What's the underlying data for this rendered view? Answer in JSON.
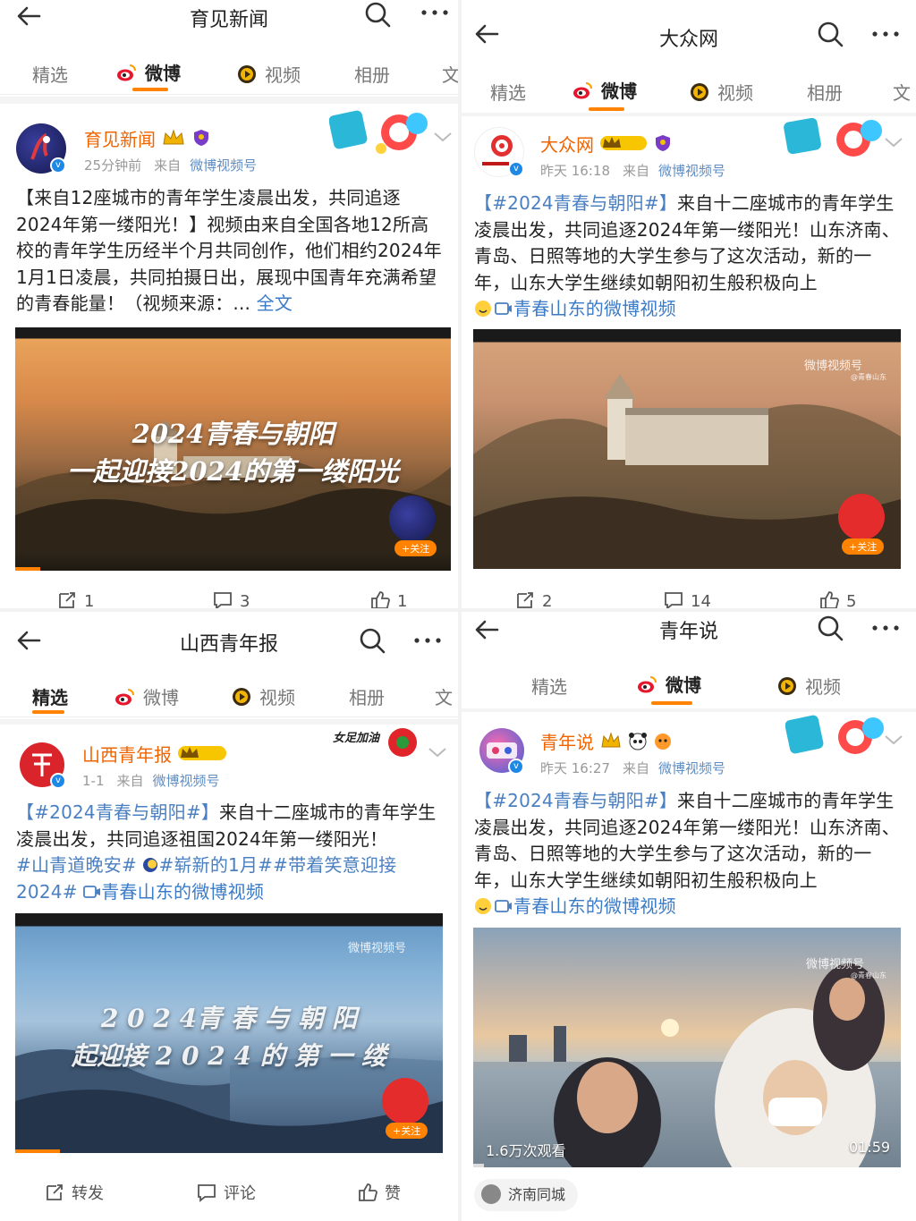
{
  "panels": [
    {
      "title": "育见新闻",
      "tabs": [
        "精选",
        "微博",
        "视频",
        "相册",
        "文"
      ],
      "active_tab": "微博",
      "user": "育见新闻",
      "time": "25分钟前",
      "from": "来自",
      "source": "微博视频号",
      "text_a": "【来自12座城市的青年学生凌晨出发，共同追逐2024年第一缕阳光！】视频由来自全国各地12所高校的青年学生历经半个月共同创作，他们相约2024年1月1日凌晨，共同拍摄日出，展现中国青年充满希望的青春能量！（视频来源：... ",
      "fulltext": "全文",
      "video_line1": "2024青春与朝阳",
      "video_line2": "一起迎接2024的第一缕阳光",
      "follow": "+关注",
      "counts": [
        "1",
        "3",
        "1"
      ]
    },
    {
      "title": "大众网",
      "tabs": [
        "精选",
        "微博",
        "视频",
        "相册",
        "文"
      ],
      "active_tab": "微博",
      "user": "大众网",
      "time": "昨天 16:18",
      "from": "来自",
      "source": "微博视频号",
      "hashtag": "【#2024青春与朝阳#】",
      "text_a": "来自十二座城市的青年学生凌晨出发，共同追逐2024年第一缕阳光！山东济南、青岛、日照等地的大学生参与了这次活动，新的一年，山东大学生继续如朝阳初生般积极向上",
      "link": "青春山东的微博视频",
      "watermark": "微博视频号",
      "watermark_sub": "@青春山东",
      "follow": "+关注",
      "counts": [
        "2",
        "14",
        "5"
      ]
    },
    {
      "title": "山西青年报",
      "tabs": [
        "精选",
        "微博",
        "视频",
        "相册",
        "文"
      ],
      "active_tab": "精选",
      "user": "山西青年报",
      "time": "1-1",
      "from": "来自",
      "source": "微博视频号",
      "hashtag": "【#2024青春与朝阳#】",
      "text_a": "来自十二座城市的青年学生凌晨出发，共同追逐祖国2024年第一缕阳光！",
      "tag1": "#山青道晚安#",
      "tag2": "#崭新的1月##带着笑意迎接2024#",
      "link": "青春山东的微博视频",
      "deco": "女足加油",
      "video_line1": "2 0 2 4青 春 与 朝 阳",
      "video_line2": "起迎接 2 0 2 4 的 第 一 缕",
      "watermark": "微博视频号",
      "follow": "+关注",
      "actions": [
        "转发",
        "评论",
        "赞"
      ]
    },
    {
      "title": "青年说",
      "tabs": [
        "精选",
        "微博",
        "视频"
      ],
      "active_tab": "微博",
      "user": "青年说",
      "time": "昨天 16:27",
      "from": "来自",
      "source": "微博视频号",
      "hashtag": "【#2024青春与朝阳#】",
      "text_a": "来自十二座城市的青年学生凌晨出发，共同追逐2024年第一缕阳光！山东济南、青岛、日照等地的大学生参与了这次活动，新的一年，山东大学生继续如朝阳初生般积极向上",
      "link": "青春山东的微博视频",
      "watermark": "微博视频号",
      "watermark_sub": "@青春山东",
      "views": "1.6万次观看",
      "duration": "01:59",
      "location": "济南同城"
    }
  ],
  "icons": [
    "back-arrow-icon",
    "search-icon",
    "more-icon",
    "weibo-logo-icon",
    "video-tab-icon",
    "verified-icon",
    "chevron-down-icon",
    "repost-icon",
    "comment-icon",
    "like-icon",
    "video-link-icon"
  ],
  "colors": {
    "accent": "#ff8200",
    "username": "#f06400",
    "link": "#4a7fc1",
    "verified": "#1e88e5"
  }
}
